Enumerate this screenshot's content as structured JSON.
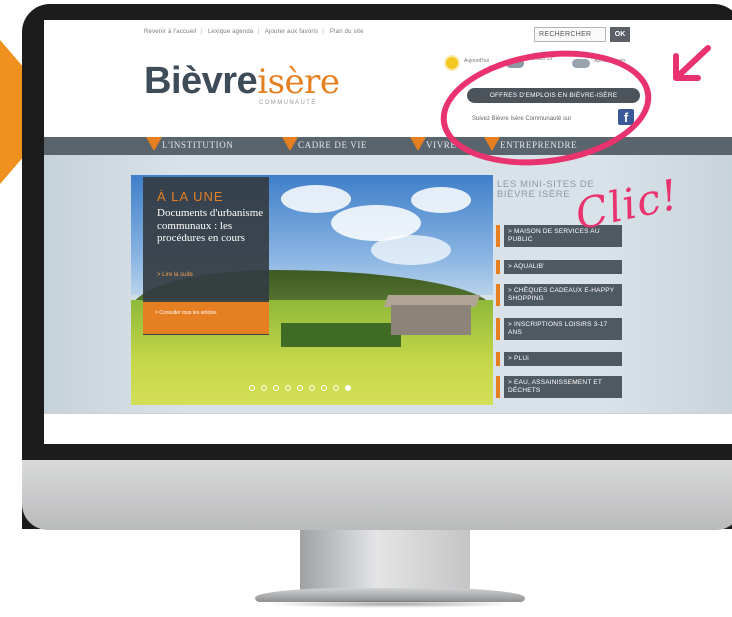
{
  "top_links": [
    "Revenir à l'accueil",
    "Lexique agenda",
    "Ajouter aux favoris",
    "Plan du site"
  ],
  "search": {
    "placeholder": "RECHERCHER",
    "button": "OK"
  },
  "logo": {
    "main": "Bièvre",
    "accent": "isère",
    "sub": "COMMUNAUTÉ"
  },
  "weather": [
    {
      "icon": "sun-icon",
      "label": "Aujourd'hui"
    },
    {
      "icon": "cloud-icon",
      "label": "Demain 19°"
    },
    {
      "icon": "cloud-icon",
      "label": "Après-demain"
    }
  ],
  "jobs_button": "OFFRES D'EMPLOIS EN BIÈVRE-ISÈRE",
  "follow_text": "Suivez Bièvre Isère Communauté sur",
  "nav": [
    "L'INSTITUTION",
    "CADRE DE VIE",
    "VIVRE",
    "ENTREPRENDRE"
  ],
  "une": {
    "title": "À LA UNE",
    "text": "Documents d'urbanisme communaux : les procédures en cours",
    "more": "> Lire la suite",
    "box": "> Consulter tous les articles"
  },
  "slider": {
    "count": 9,
    "active": 8
  },
  "mini_sites": {
    "title": "LES MINI-SITES DE BIÈVRE ISÈRE",
    "items": [
      "> MAISON DE SERVICES AU PUBLIC",
      "> AQUALIB'",
      "> CHÈQUES CADEAUX E-HAPPY SHOPPING",
      "> INSCRIPTIONS LOISIRS 3-17 ANS",
      "> PLUi",
      "> EAU, ASSAINISSEMENT ET DÉCHETS"
    ]
  },
  "annotation": {
    "text": "Clic!"
  },
  "colors": {
    "accent": "#e67e22",
    "nav": "#5a646c",
    "highlight": "#e8336f",
    "dark": "#3d4c58"
  }
}
